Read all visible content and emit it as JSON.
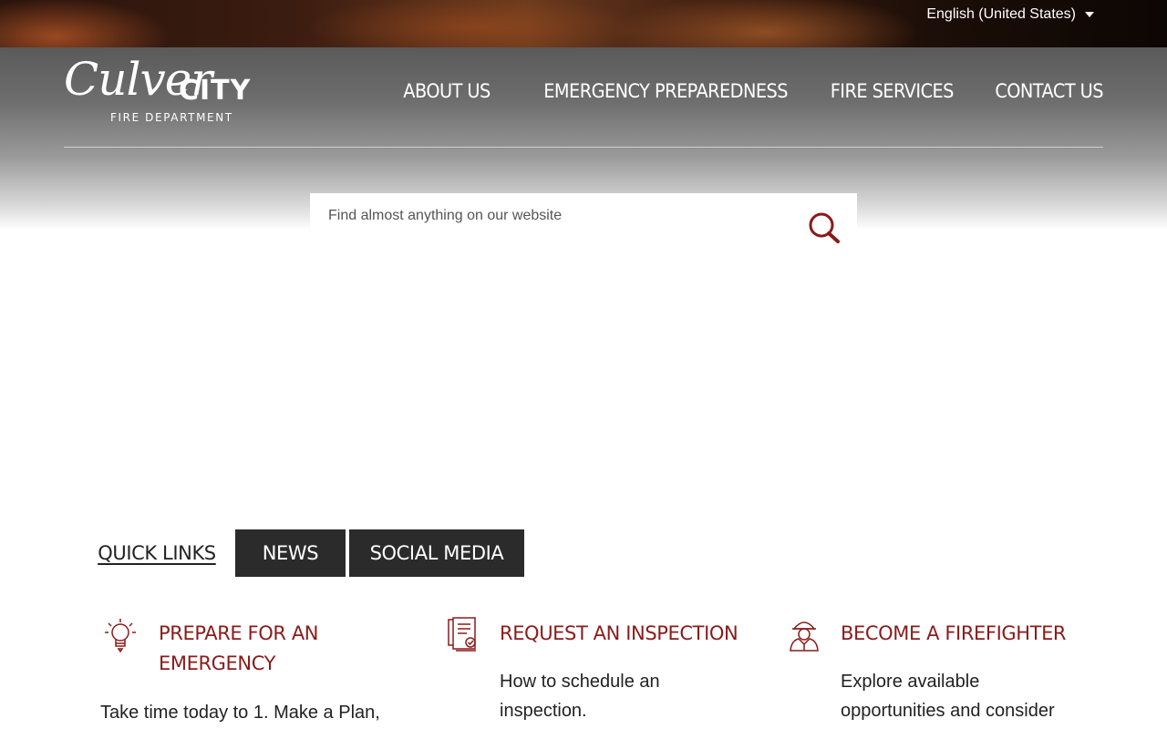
{
  "language": {
    "selected": "English (United States)"
  },
  "logo": {
    "script": "Culver",
    "city": "CITY",
    "sub": "FIRE DEPARTMENT"
  },
  "nav": {
    "items": [
      "ABOUT US",
      "EMERGENCY PREPAREDNESS",
      "FIRE SERVICES",
      "CONTACT US"
    ]
  },
  "search": {
    "placeholder": "Find almost anything on our website"
  },
  "tabs": {
    "items": [
      "QUICK LINKS",
      "NEWS",
      "SOCIAL MEDIA"
    ],
    "active": "QUICK LINKS"
  },
  "cards": [
    {
      "icon": "lightbulb-icon",
      "title": "PREPARE FOR AN EMERGENCY",
      "desc": "Take time today to 1. Make a Plan,"
    },
    {
      "icon": "document-inspection-icon",
      "title": "REQUEST AN INSPECTION",
      "desc": "How to schedule an inspection."
    },
    {
      "icon": "firefighter-icon",
      "title": "BECOME A FIREFIGHTER",
      "desc": "Explore available opportunities and consider"
    }
  ],
  "colors": {
    "accent": "#8a1b1b",
    "tab_dark": "#2b2b2b"
  }
}
